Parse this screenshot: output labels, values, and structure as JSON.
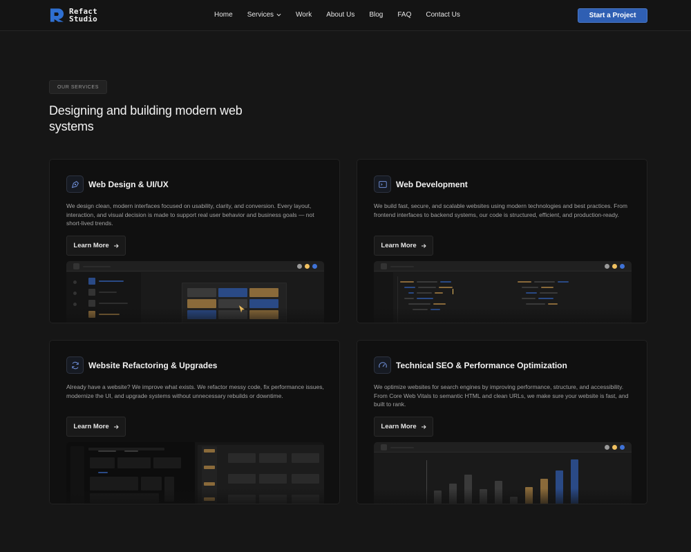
{
  "brand": {
    "line1": "Refact",
    "line2": "Studio",
    "accent": "#2f6fd0"
  },
  "nav": {
    "items": [
      {
        "label": "Home"
      },
      {
        "label": "Services",
        "has_dropdown": true
      },
      {
        "label": "Work"
      },
      {
        "label": "About Us"
      },
      {
        "label": "Blog"
      },
      {
        "label": "FAQ"
      },
      {
        "label": "Contact Us"
      }
    ],
    "cta_label": "Start a Project"
  },
  "section": {
    "badge": "OUR SERVICES",
    "heading": "Designing and building modern web systems"
  },
  "cards": [
    {
      "icon": "pen-tool-icon",
      "title": "Web Design & UI/UX",
      "description": "We design clean, modern interfaces focused on usability, clarity, and conversion. Every layout, interaction, and visual decision is made to support real user behavior and business goals — not short-lived trends.",
      "button_label": "Learn More"
    },
    {
      "icon": "terminal-icon",
      "title": "Web Development",
      "description": "We build fast, secure, and scalable websites using modern technologies and best practices. From frontend interfaces to backend systems, our code is structured, efficient, and production-ready.",
      "button_label": "Learn More"
    },
    {
      "icon": "refresh-icon",
      "title": "Website Refactoring & Upgrades",
      "description": "Already have a website? We improve what exists. We refactor messy code, fix performance issues, modernize the UI, and upgrade systems without unnecessary rebuilds or downtime.",
      "button_label": "Learn More"
    },
    {
      "icon": "gauge-icon",
      "title": "Technical SEO & Performance Optimization",
      "description": "We optimize websites for search engines by improving performance, structure, and accessibility. From Core Web Vitals to semantic HTML and clean URLs, we make sure your website is fast, and built to rank.",
      "button_label": "Learn More"
    }
  ],
  "colors": {
    "dot_gray": "#9a9a9a",
    "dot_yellow": "#f0c060",
    "dot_blue": "#3f72d6",
    "gold": "#8a6a3a",
    "blue": "#2a4a86"
  }
}
